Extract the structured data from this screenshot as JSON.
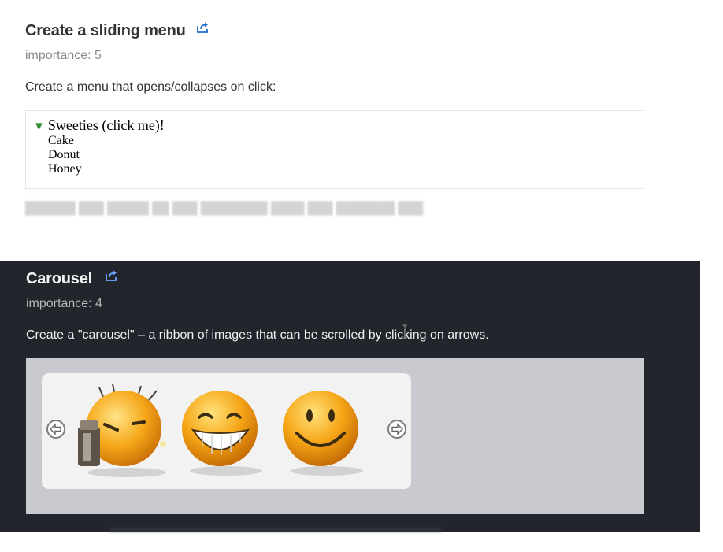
{
  "task1": {
    "title": "Create a sliding menu",
    "importance": "importance: 5",
    "description": "Create a menu that opens/collapses on click:",
    "demo": {
      "arrow": "▼",
      "menu_title": "Sweeties (click me)!",
      "items": [
        "Cake",
        "Donut",
        "Honey"
      ]
    }
  },
  "task2": {
    "title": "Carousel",
    "importance": "importance: 4",
    "description": "Create a \"carousel\" – a ribbon of images that can be scrolled by clicking on arrows.",
    "carousel": {
      "images": [
        "sleeping-smiley",
        "grinning-smiley",
        "smiling-smiley"
      ],
      "left_arrow": "arrow-left-icon",
      "right_arrow": "arrow-right-icon"
    }
  },
  "colors": {
    "dark_bg": "#22252c",
    "menu_arrow": "#2e8b2e",
    "smiley_yellow": "#f4a316",
    "carousel_frame": "#c9cad0"
  }
}
